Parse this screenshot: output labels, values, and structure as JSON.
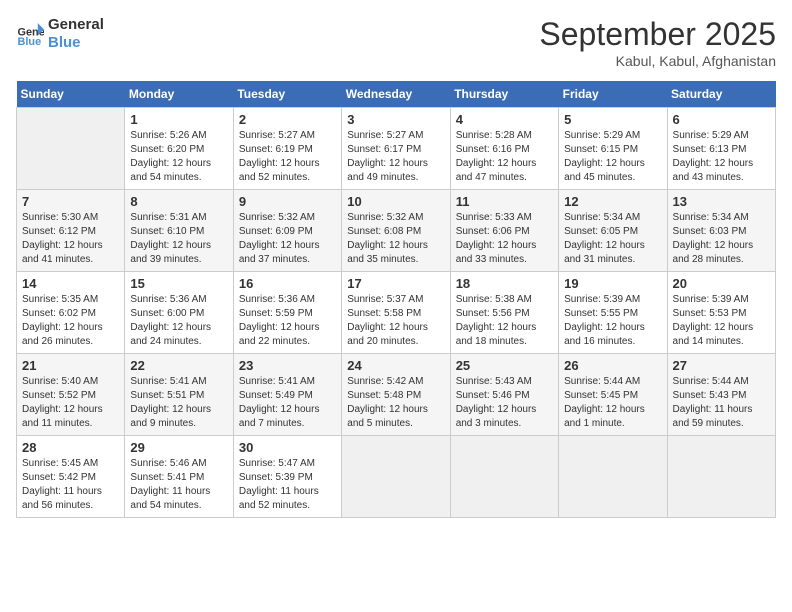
{
  "logo": {
    "line1": "General",
    "line2": "Blue"
  },
  "title": "September 2025",
  "subtitle": "Kabul, Kabul, Afghanistan",
  "weekdays": [
    "Sunday",
    "Monday",
    "Tuesday",
    "Wednesday",
    "Thursday",
    "Friday",
    "Saturday"
  ],
  "weeks": [
    [
      {
        "day": "",
        "info": ""
      },
      {
        "day": "1",
        "info": "Sunrise: 5:26 AM\nSunset: 6:20 PM\nDaylight: 12 hours\nand 54 minutes."
      },
      {
        "day": "2",
        "info": "Sunrise: 5:27 AM\nSunset: 6:19 PM\nDaylight: 12 hours\nand 52 minutes."
      },
      {
        "day": "3",
        "info": "Sunrise: 5:27 AM\nSunset: 6:17 PM\nDaylight: 12 hours\nand 49 minutes."
      },
      {
        "day": "4",
        "info": "Sunrise: 5:28 AM\nSunset: 6:16 PM\nDaylight: 12 hours\nand 47 minutes."
      },
      {
        "day": "5",
        "info": "Sunrise: 5:29 AM\nSunset: 6:15 PM\nDaylight: 12 hours\nand 45 minutes."
      },
      {
        "day": "6",
        "info": "Sunrise: 5:29 AM\nSunset: 6:13 PM\nDaylight: 12 hours\nand 43 minutes."
      }
    ],
    [
      {
        "day": "7",
        "info": "Sunrise: 5:30 AM\nSunset: 6:12 PM\nDaylight: 12 hours\nand 41 minutes."
      },
      {
        "day": "8",
        "info": "Sunrise: 5:31 AM\nSunset: 6:10 PM\nDaylight: 12 hours\nand 39 minutes."
      },
      {
        "day": "9",
        "info": "Sunrise: 5:32 AM\nSunset: 6:09 PM\nDaylight: 12 hours\nand 37 minutes."
      },
      {
        "day": "10",
        "info": "Sunrise: 5:32 AM\nSunset: 6:08 PM\nDaylight: 12 hours\nand 35 minutes."
      },
      {
        "day": "11",
        "info": "Sunrise: 5:33 AM\nSunset: 6:06 PM\nDaylight: 12 hours\nand 33 minutes."
      },
      {
        "day": "12",
        "info": "Sunrise: 5:34 AM\nSunset: 6:05 PM\nDaylight: 12 hours\nand 31 minutes."
      },
      {
        "day": "13",
        "info": "Sunrise: 5:34 AM\nSunset: 6:03 PM\nDaylight: 12 hours\nand 28 minutes."
      }
    ],
    [
      {
        "day": "14",
        "info": "Sunrise: 5:35 AM\nSunset: 6:02 PM\nDaylight: 12 hours\nand 26 minutes."
      },
      {
        "day": "15",
        "info": "Sunrise: 5:36 AM\nSunset: 6:00 PM\nDaylight: 12 hours\nand 24 minutes."
      },
      {
        "day": "16",
        "info": "Sunrise: 5:36 AM\nSunset: 5:59 PM\nDaylight: 12 hours\nand 22 minutes."
      },
      {
        "day": "17",
        "info": "Sunrise: 5:37 AM\nSunset: 5:58 PM\nDaylight: 12 hours\nand 20 minutes."
      },
      {
        "day": "18",
        "info": "Sunrise: 5:38 AM\nSunset: 5:56 PM\nDaylight: 12 hours\nand 18 minutes."
      },
      {
        "day": "19",
        "info": "Sunrise: 5:39 AM\nSunset: 5:55 PM\nDaylight: 12 hours\nand 16 minutes."
      },
      {
        "day": "20",
        "info": "Sunrise: 5:39 AM\nSunset: 5:53 PM\nDaylight: 12 hours\nand 14 minutes."
      }
    ],
    [
      {
        "day": "21",
        "info": "Sunrise: 5:40 AM\nSunset: 5:52 PM\nDaylight: 12 hours\nand 11 minutes."
      },
      {
        "day": "22",
        "info": "Sunrise: 5:41 AM\nSunset: 5:51 PM\nDaylight: 12 hours\nand 9 minutes."
      },
      {
        "day": "23",
        "info": "Sunrise: 5:41 AM\nSunset: 5:49 PM\nDaylight: 12 hours\nand 7 minutes."
      },
      {
        "day": "24",
        "info": "Sunrise: 5:42 AM\nSunset: 5:48 PM\nDaylight: 12 hours\nand 5 minutes."
      },
      {
        "day": "25",
        "info": "Sunrise: 5:43 AM\nSunset: 5:46 PM\nDaylight: 12 hours\nand 3 minutes."
      },
      {
        "day": "26",
        "info": "Sunrise: 5:44 AM\nSunset: 5:45 PM\nDaylight: 12 hours\nand 1 minute."
      },
      {
        "day": "27",
        "info": "Sunrise: 5:44 AM\nSunset: 5:43 PM\nDaylight: 11 hours\nand 59 minutes."
      }
    ],
    [
      {
        "day": "28",
        "info": "Sunrise: 5:45 AM\nSunset: 5:42 PM\nDaylight: 11 hours\nand 56 minutes."
      },
      {
        "day": "29",
        "info": "Sunrise: 5:46 AM\nSunset: 5:41 PM\nDaylight: 11 hours\nand 54 minutes."
      },
      {
        "day": "30",
        "info": "Sunrise: 5:47 AM\nSunset: 5:39 PM\nDaylight: 11 hours\nand 52 minutes."
      },
      {
        "day": "",
        "info": ""
      },
      {
        "day": "",
        "info": ""
      },
      {
        "day": "",
        "info": ""
      },
      {
        "day": "",
        "info": ""
      }
    ]
  ]
}
